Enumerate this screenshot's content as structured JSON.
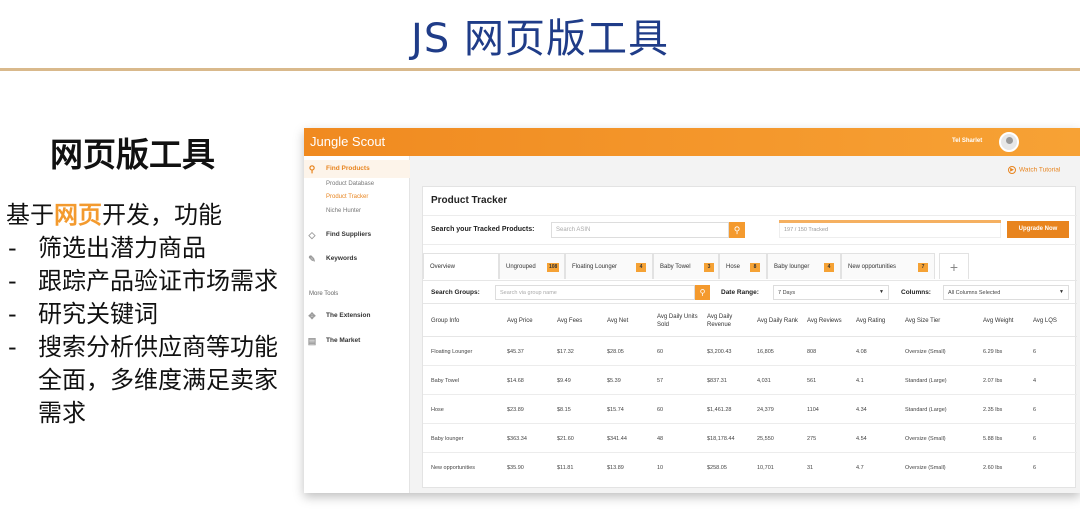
{
  "slide": {
    "title": "JS 网页版工具",
    "left_heading": "网页版工具",
    "intro_before": "基于",
    "intro_highlight": "网页",
    "intro_after": "开发，功能",
    "bullets": [
      "筛选出潜力商品",
      "跟踪产品验证市场需求",
      "研究关键词",
      "搜索分析供应商等功能全面，多维度满足卖家需求"
    ]
  },
  "app": {
    "brand": "Jungle Scout",
    "user_name": "Tel Sharlet",
    "watch_tutorial": "Watch Tutorial",
    "sidebar": {
      "find_products": "Find Products",
      "sub_items": [
        "Product Database",
        "Product Tracker",
        "Niche Hunter"
      ],
      "find_suppliers": "Find Suppliers",
      "keywords": "Keywords",
      "more_tools": "More Tools",
      "the_extension": "The Extension",
      "the_market": "The Market"
    },
    "page_title": "Product Tracker",
    "search": {
      "label": "Search your Tracked Products:",
      "placeholder": "Search ASIN",
      "tracker_text": "197 / 150 Tracked",
      "upgrade": "Upgrade Now"
    },
    "tabs": [
      {
        "label": "Overview",
        "badge": ""
      },
      {
        "label": "Ungrouped",
        "badge": "108"
      },
      {
        "label": "Floating Lounger",
        "badge": "4"
      },
      {
        "label": "Baby Towel",
        "badge": "3"
      },
      {
        "label": "Hose",
        "badge": "8"
      },
      {
        "label": "Baby lounger",
        "badge": "4"
      },
      {
        "label": "New opportunities",
        "badge": "7"
      }
    ],
    "filters": {
      "search_groups_label": "Search Groups:",
      "search_groups_placeholder": "Search via group name",
      "date_range_label": "Date Range:",
      "date_range_value": "7 Days",
      "columns_label": "Columns:",
      "columns_value": "All Columns Selected"
    },
    "table": {
      "headers": [
        "Group Info",
        "Avg Price",
        "Avg Fees",
        "Avg Net",
        "Avg Daily Units Sold",
        "Avg Daily Revenue",
        "Avg Daily Rank",
        "Avg Reviews",
        "Avg Rating",
        "Avg Size Tier",
        "Avg Weight",
        "Avg LQS"
      ],
      "rows": [
        [
          "Floating Lounger",
          "$45.37",
          "$17.32",
          "$28.05",
          "60",
          "$3,200.43",
          "16,805",
          "808",
          "4.08",
          "Oversize (Small)",
          "6.29 lbs",
          "6"
        ],
        [
          "Baby Towel",
          "$14.68",
          "$9.49",
          "$5.39",
          "57",
          "$837.31",
          "4,031",
          "561",
          "4.1",
          "Standard (Large)",
          "2.07 lbs",
          "4"
        ],
        [
          "Hose",
          "$23.89",
          "$8.15",
          "$15.74",
          "60",
          "$1,461.28",
          "24,379",
          "1104",
          "4.34",
          "Standard (Large)",
          "2.35 lbs",
          "6"
        ],
        [
          "Baby lounger",
          "$363.34",
          "$21.60",
          "$341.44",
          "48",
          "$18,178.44",
          "25,550",
          "275",
          "4.54",
          "Oversize (Small)",
          "5.88 lbs",
          "6"
        ],
        [
          "New opportunities",
          "$35.90",
          "$11.81",
          "$13.89",
          "10",
          "$258.05",
          "10,701",
          "31",
          "4.7",
          "Oversize (Small)",
          "2.60 lbs",
          "6"
        ]
      ]
    }
  }
}
